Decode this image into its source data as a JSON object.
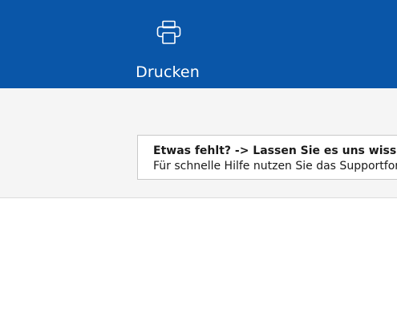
{
  "ribbon": {
    "background": "#0a56a8",
    "print_button": {
      "icon": "printer-icon",
      "label": "Drucken"
    }
  },
  "feedback": {
    "title": "Etwas fehlt? -> Lassen Sie es uns wiss",
    "body": "Für schnelle Hilfe nutzen Sie das Supportfor"
  }
}
